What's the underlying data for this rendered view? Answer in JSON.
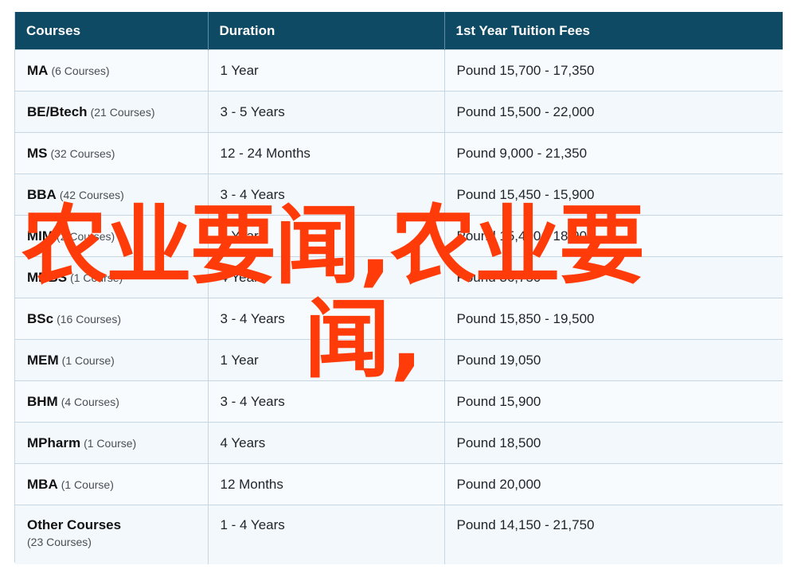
{
  "table": {
    "headers": [
      "Courses",
      "Duration",
      "1st Year Tuition Fees"
    ],
    "rows": [
      {
        "course": "MA",
        "count": "(6 Courses)",
        "duration": "1 Year",
        "fees": "Pound 15,700 - 17,350"
      },
      {
        "course": "BE/Btech",
        "count": "(21 Courses)",
        "duration": "3 - 5 Years",
        "fees": "Pound 15,500 - 22,000"
      },
      {
        "course": "MS",
        "count": "(32 Courses)",
        "duration": "12 - 24 Months",
        "fees": "Pound 9,000 - 21,350"
      },
      {
        "course": "BBA",
        "count": "(42 Courses)",
        "duration": "3 - 4 Years",
        "fees": "Pound 15,450 - 15,900"
      },
      {
        "course": "MIM",
        "count": "(2 Courses)",
        "duration": "1 Year",
        "fees": "Pound 15,400 - 18,900"
      },
      {
        "course": "MBBS",
        "count": "(1 Course)",
        "duration": "4 Years",
        "fees": "Pound 36,750"
      },
      {
        "course": "BSc",
        "count": "(16 Courses)",
        "duration": "3 - 4 Years",
        "fees": "Pound 15,850 - 19,500"
      },
      {
        "course": "MEM",
        "count": "(1 Course)",
        "duration": "1 Year",
        "fees": "Pound 19,050"
      },
      {
        "course": "BHM",
        "count": "(4 Courses)",
        "duration": "3 - 4 Years",
        "fees": "Pound 15,900"
      },
      {
        "course": "MPharm",
        "count": "(1 Course)",
        "duration": "4 Years",
        "fees": "Pound 18,500"
      },
      {
        "course": "MBA",
        "count": "(1 Course)",
        "duration": "12 Months",
        "fees": "Pound 20,000"
      },
      {
        "course": "Other Courses",
        "count": "(23 Courses)",
        "duration": "1 - 4 Years",
        "fees": "Pound 14,150 - 21,750"
      }
    ]
  },
  "watermark": {
    "line1": "农业要闻,农业要",
    "line2": "闻,",
    "color": "#ff3b0a"
  }
}
